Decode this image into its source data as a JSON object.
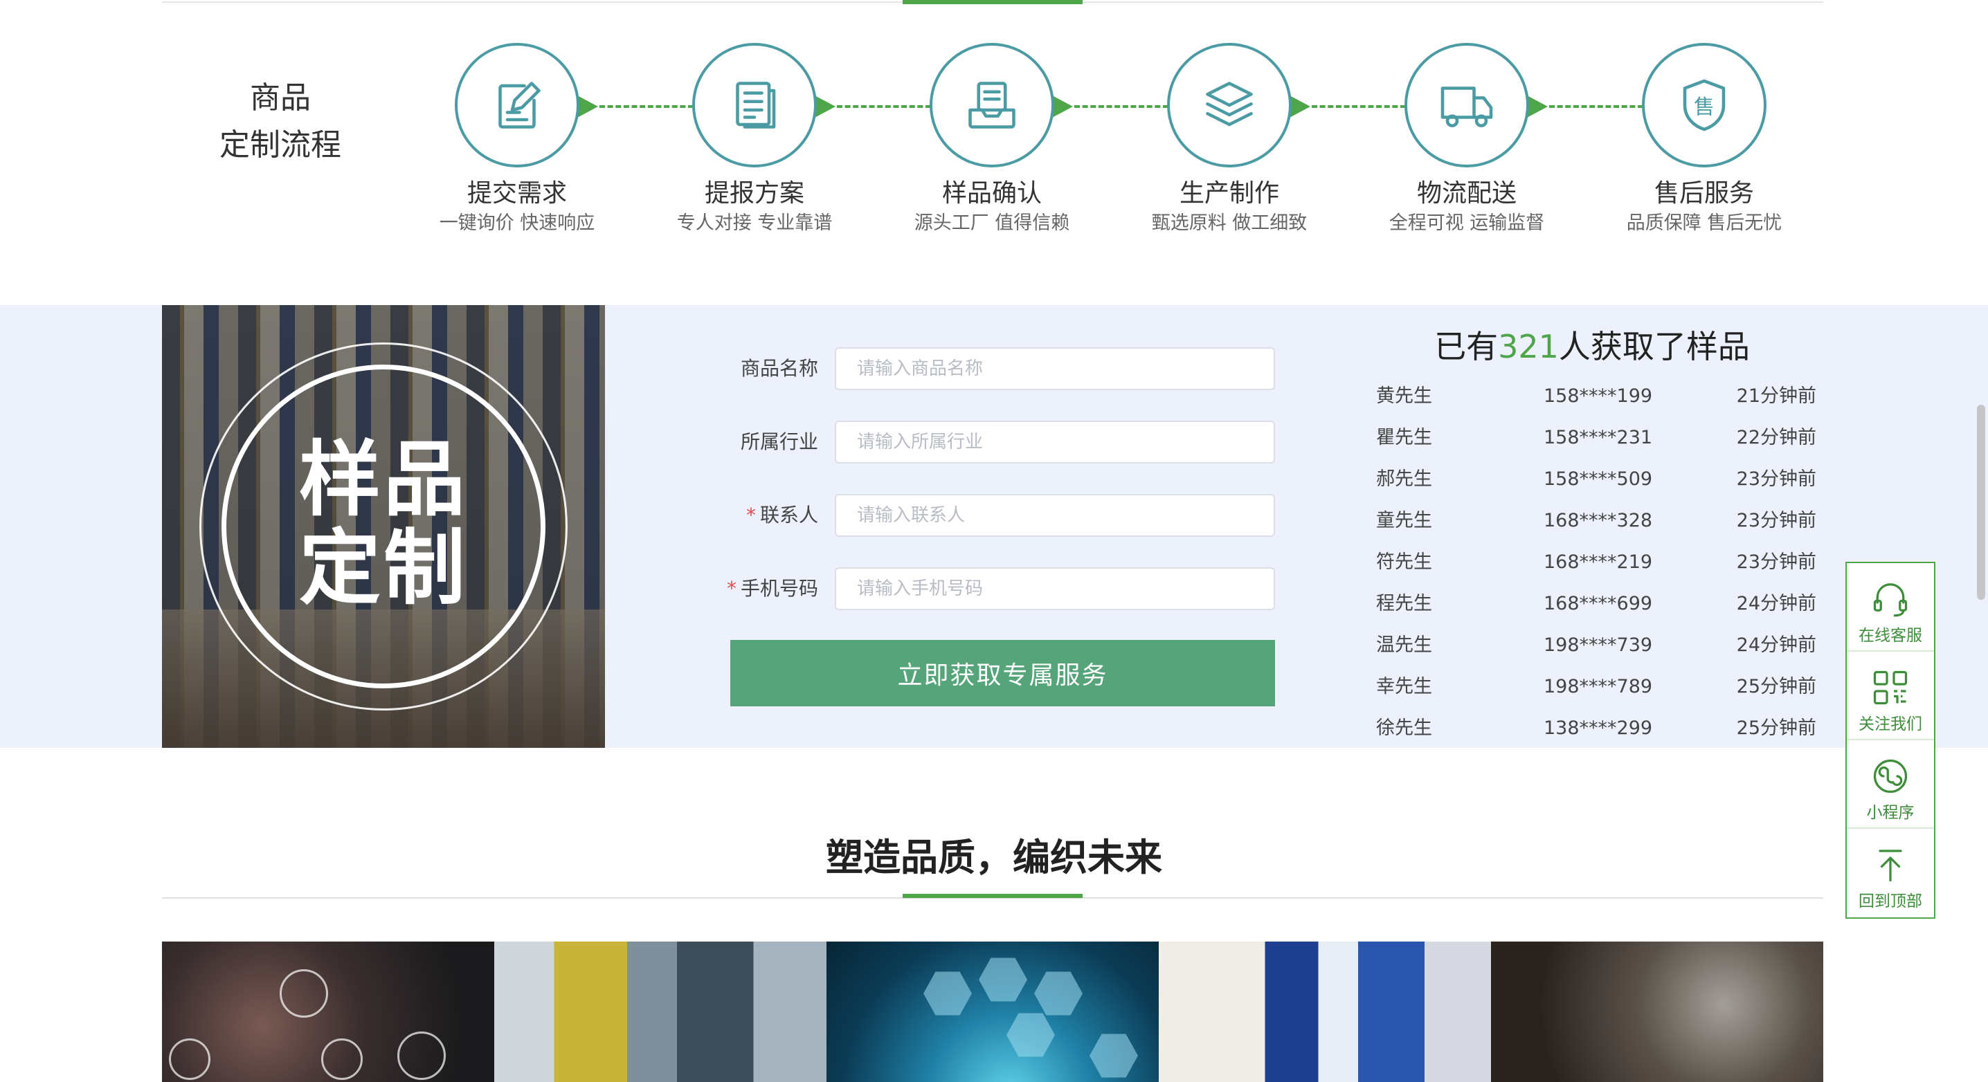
{
  "process": {
    "title_line1": "商品",
    "title_line2": "定制流程",
    "steps": [
      {
        "icon": "edit-doc-icon",
        "name": "提交需求",
        "desc": "一键询价 快速响应"
      },
      {
        "icon": "document-icon",
        "name": "提报方案",
        "desc": "专人对接 专业靠谱"
      },
      {
        "icon": "inbox-confirm-icon",
        "name": "样品确认",
        "desc": "源头工厂 值得信赖"
      },
      {
        "icon": "layers-icon",
        "name": "生产制作",
        "desc": "甄选原料 做工细致"
      },
      {
        "icon": "truck-icon",
        "name": "物流配送",
        "desc": "全程可视 运输监督"
      },
      {
        "icon": "shield-sale-icon",
        "name": "售后服务",
        "desc": "品质保障 售后无忧"
      }
    ],
    "shield_char": "售"
  },
  "hero": {
    "line1": "样品",
    "line2": "定制"
  },
  "form": {
    "fields": [
      {
        "label": "商品名称",
        "required": false,
        "placeholder": "请输入商品名称"
      },
      {
        "label": "所属行业",
        "required": false,
        "placeholder": "请输入所属行业"
      },
      {
        "label": "联系人",
        "required": true,
        "placeholder": "请输入联系人"
      },
      {
        "label": "手机号码",
        "required": true,
        "placeholder": "请输入手机号码"
      }
    ],
    "required_mark": "*",
    "submit_label": "立即获取专属服务"
  },
  "samples": {
    "title_prefix": "已有",
    "title_count": "321",
    "title_suffix": "人获取了样品",
    "rows": [
      {
        "name": "黄先生",
        "phone": "158****199",
        "time": "21分钟前"
      },
      {
        "name": "瞿先生",
        "phone": "158****231",
        "time": "22分钟前"
      },
      {
        "name": "郝先生",
        "phone": "158****509",
        "time": "23分钟前"
      },
      {
        "name": "童先生",
        "phone": "168****328",
        "time": "23分钟前"
      },
      {
        "name": "符先生",
        "phone": "168****219",
        "time": "23分钟前"
      },
      {
        "name": "程先生",
        "phone": "168****699",
        "time": "24分钟前"
      },
      {
        "name": "温先生",
        "phone": "198****739",
        "time": "24分钟前"
      },
      {
        "name": "幸先生",
        "phone": "198****789",
        "time": "25分钟前"
      },
      {
        "name": "徐先生",
        "phone": "138****299",
        "time": "25分钟前"
      }
    ]
  },
  "quality": {
    "title": "塑造品质，编织未来",
    "images": [
      "tech-icons-photo",
      "factory-pipes-photo",
      "quality-hexagon-photo",
      "warehouse-racks-photo",
      "robot-arm-photo"
    ]
  },
  "sidebar": {
    "items": [
      {
        "icon": "headset-icon",
        "label": "在线客服"
      },
      {
        "icon": "qrcode-icon",
        "label": "关注我们"
      },
      {
        "icon": "mini-program-icon",
        "label": "小程序"
      },
      {
        "icon": "arrow-up-icon",
        "label": "回到顶部"
      }
    ]
  },
  "colors": {
    "accent_green": "#4fa54a",
    "icon_teal": "#4a9ba4",
    "button_green": "#56a57a",
    "band_bg": "#ecf1fb",
    "required_red": "#e05050"
  }
}
